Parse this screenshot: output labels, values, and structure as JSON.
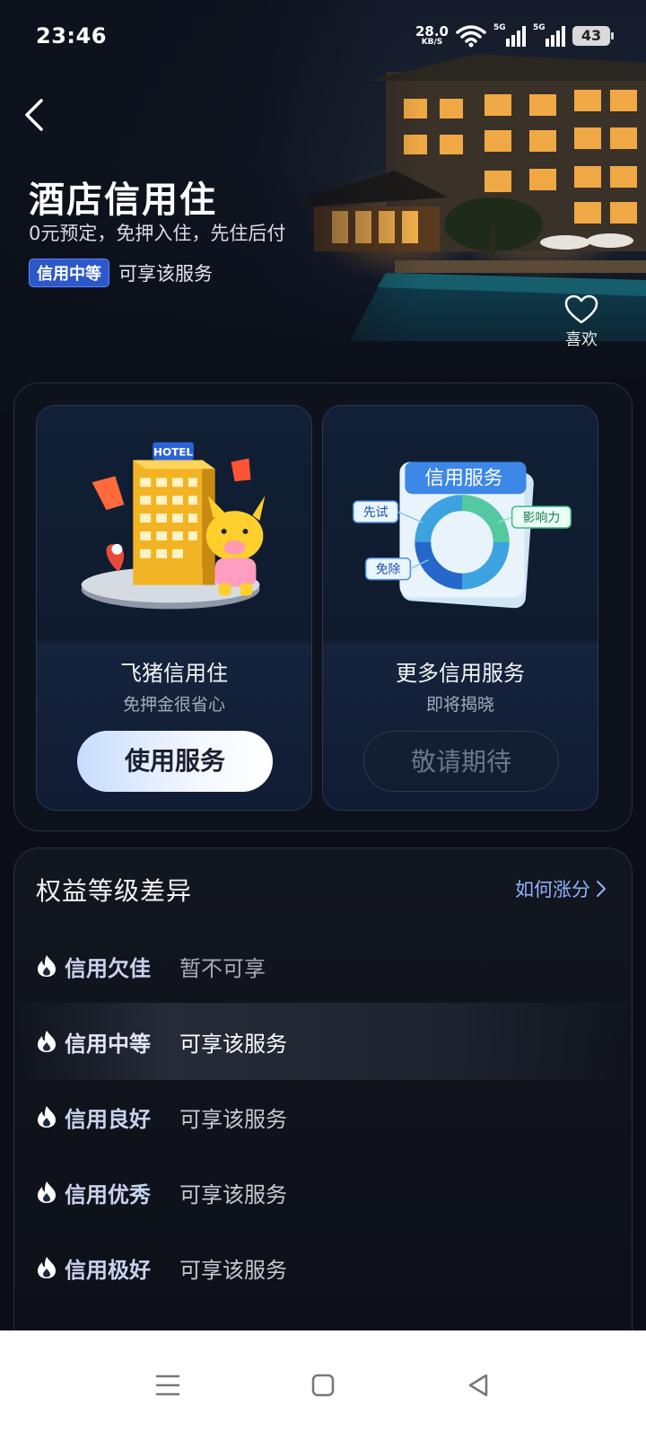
{
  "status_bar": {
    "time": "23:46",
    "net_speed": "28.0",
    "net_unit": "KB/S",
    "sim1_label": "5G",
    "sim2_label": "5G",
    "battery": "43"
  },
  "header": {
    "title": "酒店信用住",
    "subtitle": "0元预定，免押入住，先住后付",
    "level_badge": "信用中等",
    "level_text": "可享该服务",
    "like_label": "喜欢"
  },
  "cards": [
    {
      "art_sign": "HOTEL",
      "title": "飞猪信用住",
      "desc": "免押金很省心",
      "button": "使用服务"
    },
    {
      "art_header": "信用服务",
      "art_tags": [
        "先试",
        "影响力",
        "免除"
      ],
      "title": "更多信用服务",
      "desc": "即将揭晓",
      "button": "敬请期待"
    }
  ],
  "benefits": {
    "title": "权益等级差异",
    "link": "如何涨分",
    "tiers": [
      {
        "name": "信用欠佳",
        "status": "暂不可享"
      },
      {
        "name": "信用中等",
        "status": "可享该服务",
        "active": true
      },
      {
        "name": "信用良好",
        "status": "可享该服务"
      },
      {
        "name": "信用优秀",
        "status": "可享该服务"
      },
      {
        "name": "信用极好",
        "status": "可享该服务"
      }
    ]
  },
  "colors": {
    "background": "#0b0e16",
    "accent": "#2c58c9",
    "link": "#8fb3ff",
    "primary_button": "#e6efff"
  },
  "icons": {
    "back": "chevron-left-icon",
    "like": "heart-icon",
    "tier": "flame-icon",
    "nav": [
      "menu-icon",
      "home-square-icon",
      "back-triangle-icon"
    ]
  }
}
